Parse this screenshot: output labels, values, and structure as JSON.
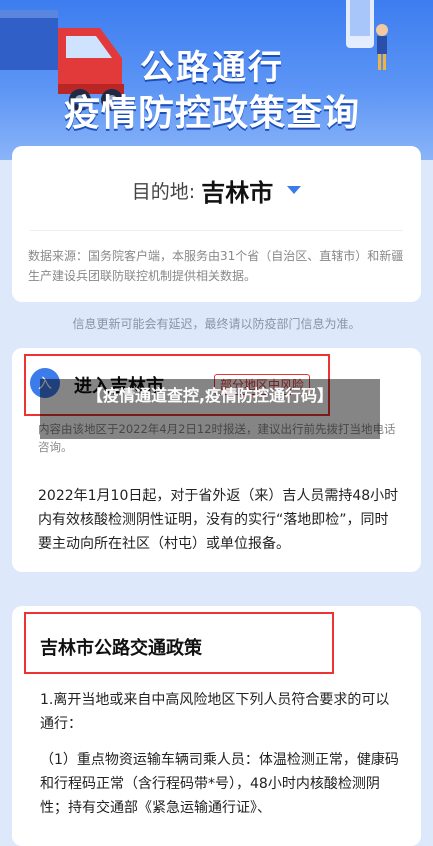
{
  "banner": {
    "title_line1": "公路通行",
    "title_line2": "疫情防控政策查询"
  },
  "destination": {
    "label": "目的地:",
    "value": "吉林市"
  },
  "source_text": "数据来源：国务院客户端，本服务由31个省（自治区、直辖市）和新疆生产建设兵团联防联控机制提供相关数据。",
  "notice": "信息更新可能会有延迟，最终请以防疫部门信息为准。",
  "entry": {
    "icon": "入",
    "title": "进入吉林市",
    "badge": "部分地区中风险",
    "report": "内容由该地区于2022年4月2日12时报送，建议出行前先拨打当地电话咨询。",
    "body": "2022年1月10日起，对于省外返（来）吉人员需持48小时内有效核酸检测阴性证明，没有的实行“落地即检”，同时要主动向所在社区（村屯）或单位报备。"
  },
  "overlay": {
    "text": "【疫情通道查控,疫情防控通行码】"
  },
  "policy": {
    "title": "吉林市公路交通政策",
    "p1": "1.离开当地或来自中高风险地区下列人员符合要求的可以通行：",
    "p2": "（1）重点物资运输车辆司乘人员：体温检测正常，健康码和行程码正常（含行程码带*号），48小时内核酸检测阴性；持有交通部《紧急运输通行证》、"
  },
  "colors": {
    "accent": "#3c7bea",
    "highlight_red": "#ee3333",
    "banner_blue": "#3d7df0"
  }
}
